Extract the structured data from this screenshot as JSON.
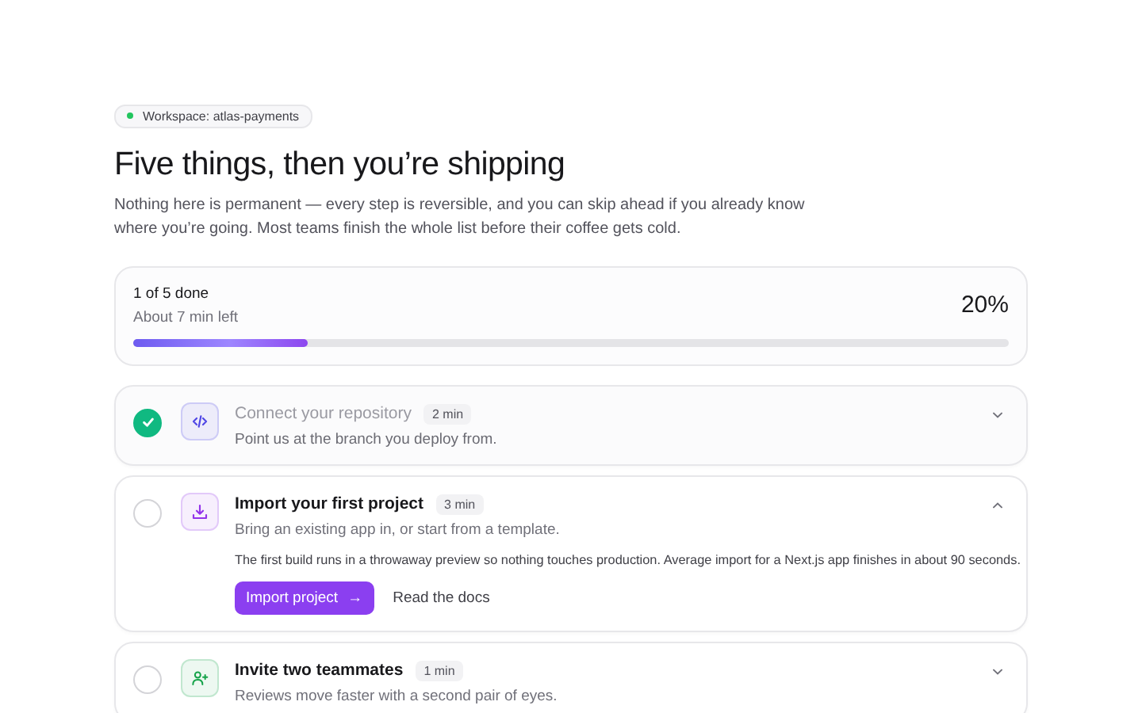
{
  "workspace": {
    "label": "Workspace: atlas-payments",
    "color": "#22c55e"
  },
  "title": "Five things, then you’re shipping",
  "intro": "Nothing here is permanent — every step is reversible, and you can skip ahead if you already know where you’re going. Most teams finish the whole list before their coffee gets cold.",
  "progress": {
    "done": "1 of 5 done",
    "remaining": "About 7 min left",
    "percent": "20%",
    "level": 0.2
  },
  "steps": [
    {
      "title": "Connect your repository",
      "time": "2 min",
      "description": "Point us at the branch you deploy from.",
      "kind": "code",
      "color": "#4f46e5",
      "checked": true,
      "expanded": false
    },
    {
      "title": "Import your first project",
      "time": "3 min",
      "description": "Bring an existing app in, or start from a template.",
      "kind": "download",
      "color": "#9333ea",
      "checked": false,
      "expanded": true,
      "details": "The first build runs in a throwaway preview so nothing touches production. Average import for a Next.js app finishes in about 90 seconds.",
      "primary_action": {
        "label": "Import project",
        "arrow": "→"
      },
      "secondary_action": "Read the docs"
    },
    {
      "title": "Invite two teammates",
      "time": "1 min",
      "description": "Reviews move faster with a second pair of eyes.",
      "kind": "invite",
      "color": "#16a34a",
      "checked": false,
      "expanded": false
    }
  ]
}
